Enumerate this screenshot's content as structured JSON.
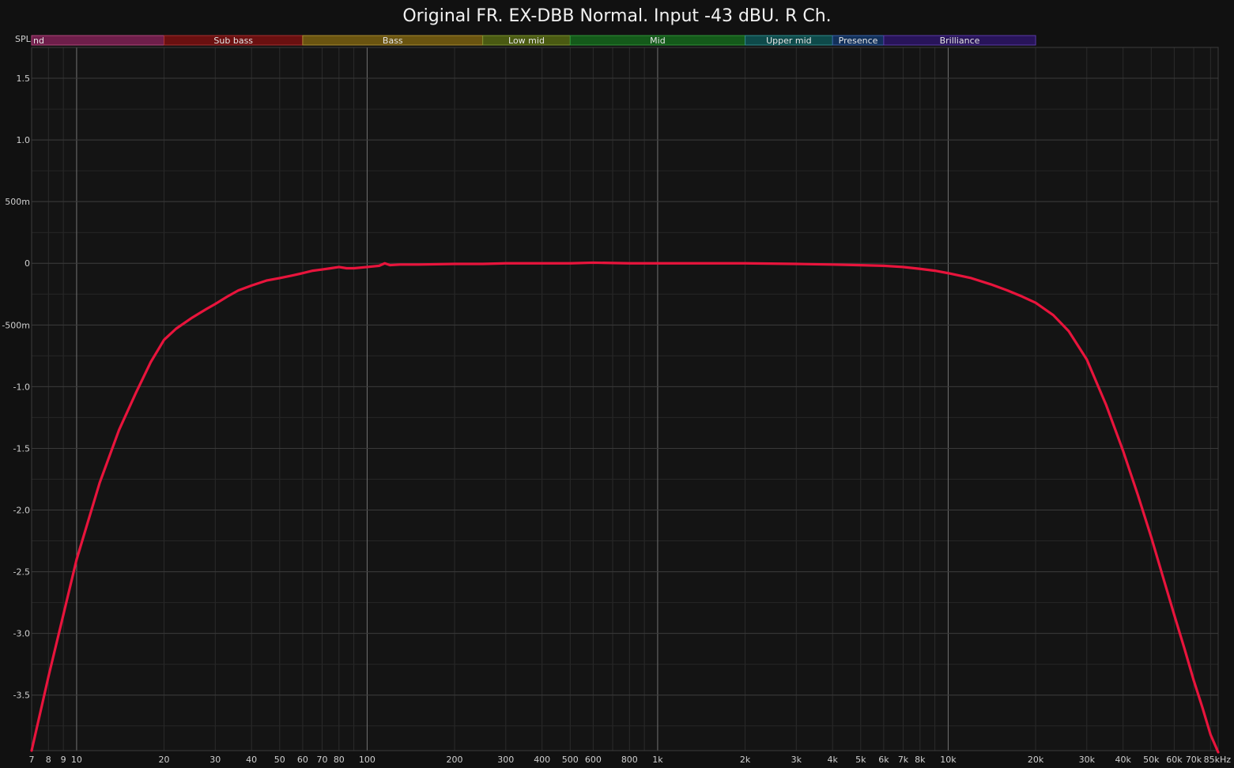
{
  "chart_data": {
    "type": "line",
    "title": "Original FR. EX-DBB Normal. Input -43 dBU. R Ch.",
    "ylabel": "SPL",
    "xscale": "log",
    "xlim": [
      7,
      85000
    ],
    "ylim": [
      -3.95,
      1.75
    ],
    "grid": true,
    "y_ticks": [
      {
        "value": 1.5,
        "label": "1.5"
      },
      {
        "value": 1.0,
        "label": "1.0"
      },
      {
        "value": 0.5,
        "label": "500m"
      },
      {
        "value": 0,
        "label": "0"
      },
      {
        "value": -0.5,
        "label": "-500m"
      },
      {
        "value": -1.0,
        "label": "-1.0"
      },
      {
        "value": -1.5,
        "label": "-1.5"
      },
      {
        "value": -2.0,
        "label": "-2.0"
      },
      {
        "value": -2.5,
        "label": "-2.5"
      },
      {
        "value": -3.0,
        "label": "-3.0"
      },
      {
        "value": -3.5,
        "label": "-3.5"
      }
    ],
    "x_ticks": [
      {
        "value": 7,
        "label": "7"
      },
      {
        "value": 8,
        "label": "8"
      },
      {
        "value": 9,
        "label": "9"
      },
      {
        "value": 10,
        "label": "10"
      },
      {
        "value": 20,
        "label": "20"
      },
      {
        "value": 30,
        "label": "30"
      },
      {
        "value": 40,
        "label": "40"
      },
      {
        "value": 50,
        "label": "50"
      },
      {
        "value": 60,
        "label": "60"
      },
      {
        "value": 70,
        "label": "70"
      },
      {
        "value": 80,
        "label": "80"
      },
      {
        "value": 100,
        "label": "100"
      },
      {
        "value": 200,
        "label": "200"
      },
      {
        "value": 300,
        "label": "300"
      },
      {
        "value": 400,
        "label": "400"
      },
      {
        "value": 500,
        "label": "500"
      },
      {
        "value": 600,
        "label": "600"
      },
      {
        "value": 800,
        "label": "800"
      },
      {
        "value": 1000,
        "label": "1k"
      },
      {
        "value": 2000,
        "label": "2k"
      },
      {
        "value": 3000,
        "label": "3k"
      },
      {
        "value": 4000,
        "label": "4k"
      },
      {
        "value": 5000,
        "label": "5k"
      },
      {
        "value": 6000,
        "label": "6k"
      },
      {
        "value": 7000,
        "label": "7k"
      },
      {
        "value": 8000,
        "label": "8k"
      },
      {
        "value": 10000,
        "label": "10k"
      },
      {
        "value": 20000,
        "label": "20k"
      },
      {
        "value": 30000,
        "label": "30k"
      },
      {
        "value": 40000,
        "label": "40k"
      },
      {
        "value": 50000,
        "label": "50k"
      },
      {
        "value": 60000,
        "label": "60k"
      },
      {
        "value": 70000,
        "label": "70k"
      },
      {
        "value": 85000,
        "label": "85kHz"
      }
    ],
    "bands": [
      {
        "label": "nd",
        "from": 7,
        "to": 20,
        "fill": "#6e1e4a",
        "border": "#b0467a"
      },
      {
        "label": "Sub bass",
        "from": 20,
        "to": 60,
        "fill": "#6a1010",
        "border": "#a83030"
      },
      {
        "label": "Bass",
        "from": 60,
        "to": 250,
        "fill": "#6a5410",
        "border": "#a88a30"
      },
      {
        "label": "Low mid",
        "from": 250,
        "to": 500,
        "fill": "#4a5a12",
        "border": "#7c9430"
      },
      {
        "label": "Mid",
        "from": 500,
        "to": 2000,
        "fill": "#145a1a",
        "border": "#2f9438"
      },
      {
        "label": "Upper mid",
        "from": 2000,
        "to": 4000,
        "fill": "#0e4a4a",
        "border": "#2f8c8c"
      },
      {
        "label": "Presence",
        "from": 4000,
        "to": 6000,
        "fill": "#12305a",
        "border": "#3a64a8"
      },
      {
        "label": "Brilliance",
        "from": 6000,
        "to": 20000,
        "fill": "#28145a",
        "border": "#5a3aa8"
      }
    ],
    "series": [
      {
        "color": "#e8143c",
        "x": [
          7,
          8,
          9,
          10,
          12,
          14,
          16,
          18,
          20,
          22,
          25,
          28,
          30,
          33,
          36,
          40,
          45,
          50,
          55,
          60,
          65,
          70,
          75,
          80,
          85,
          90,
          100,
          110,
          115,
          120,
          130,
          150,
          200,
          250,
          300,
          400,
          500,
          600,
          800,
          1000,
          1500,
          2000,
          3000,
          4000,
          5000,
          6000,
          7000,
          8000,
          9000,
          10000,
          12000,
          14000,
          16000,
          18000,
          20000,
          23000,
          26000,
          30000,
          35000,
          40000,
          45000,
          50000,
          55000,
          60000,
          65000,
          70000,
          75000,
          80000,
          85000
        ],
        "values": [
          -3.95,
          -3.35,
          -2.85,
          -2.4,
          -1.78,
          -1.35,
          -1.05,
          -0.8,
          -0.62,
          -0.53,
          -0.44,
          -0.37,
          -0.33,
          -0.27,
          -0.22,
          -0.18,
          -0.14,
          -0.12,
          -0.1,
          -0.08,
          -0.06,
          -0.05,
          -0.04,
          -0.03,
          -0.04,
          -0.04,
          -0.03,
          -0.02,
          0.0,
          -0.015,
          -0.01,
          -0.01,
          -0.005,
          -0.005,
          0.0,
          0.0,
          0.0,
          0.005,
          0.0,
          0.0,
          0.0,
          0.0,
          -0.005,
          -0.01,
          -0.015,
          -0.02,
          -0.03,
          -0.045,
          -0.06,
          -0.08,
          -0.12,
          -0.17,
          -0.22,
          -0.27,
          -0.32,
          -0.42,
          -0.55,
          -0.78,
          -1.15,
          -1.52,
          -1.88,
          -2.22,
          -2.55,
          -2.85,
          -3.12,
          -3.38,
          -3.6,
          -3.82,
          -4.0
        ]
      }
    ]
  }
}
